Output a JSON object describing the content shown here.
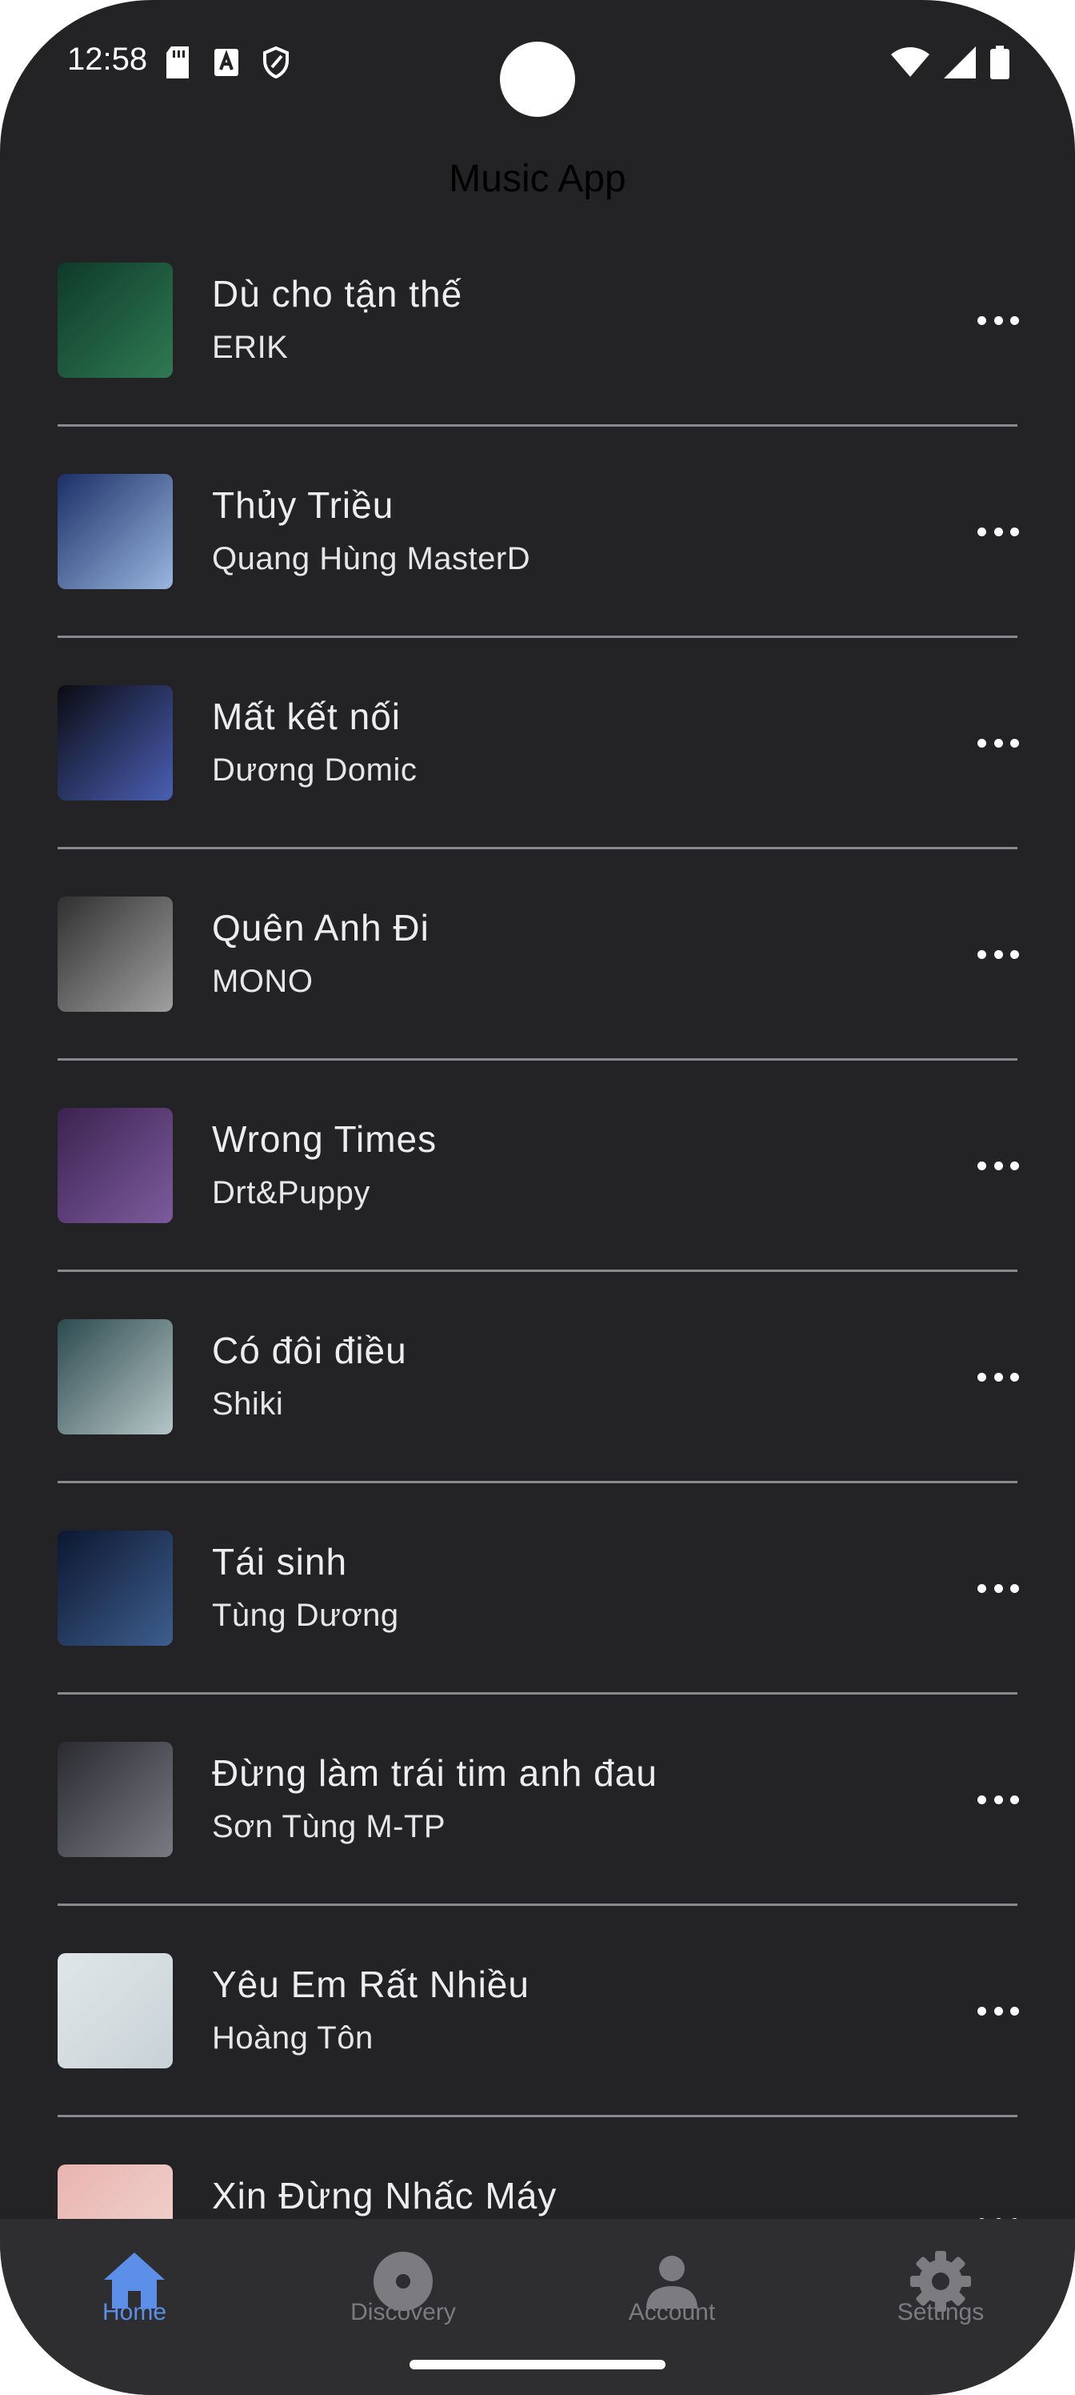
{
  "status": {
    "time": "12:58",
    "left_icons": [
      "sd-card-icon",
      "text-a-icon",
      "shield-icon"
    ],
    "right_icons": [
      "wifi-icon",
      "signal-icon",
      "battery-icon"
    ]
  },
  "app": {
    "title": "Music App"
  },
  "songs": [
    {
      "title": "Dù cho tận thế",
      "artist": "ERIK",
      "thumb_colors": [
        "#0f3a2a",
        "#2e7a52"
      ]
    },
    {
      "title": "Thủy Triều",
      "artist": "Quang Hùng MasterD",
      "thumb_colors": [
        "#1b2f66",
        "#9ab6e0"
      ]
    },
    {
      "title": "Mất kết nối",
      "artist": "Dương Domic",
      "thumb_colors": [
        "#0b0b12",
        "#4a5fb4"
      ]
    },
    {
      "title": "Quên Anh Đi",
      "artist": "MONO",
      "thumb_colors": [
        "#303030",
        "#a0a0a0"
      ]
    },
    {
      "title": "Wrong Times",
      "artist": "Drt&Puppy",
      "thumb_colors": [
        "#3b2350",
        "#7d5b9e"
      ]
    },
    {
      "title": "Có đôi điều",
      "artist": "Shiki",
      "thumb_colors": [
        "#2c4a4e",
        "#b6c6c8"
      ]
    },
    {
      "title": "Tái sinh",
      "artist": "Tùng Dương",
      "thumb_colors": [
        "#0d1730",
        "#3d5e8e"
      ]
    },
    {
      "title": "Đừng làm trái tim anh đau",
      "artist": "Sơn Tùng M-TP",
      "thumb_colors": [
        "#2a2a30",
        "#7a7a84"
      ]
    },
    {
      "title": "Yêu Em Rất Nhiều",
      "artist": "Hoàng Tôn",
      "thumb_colors": [
        "#dfe6e8",
        "#c8d2d6"
      ]
    },
    {
      "title": "Xin Đừng Nhấc Máy",
      "artist": "",
      "thumb_colors": [
        "#e8b4b0",
        "#f2d6d2"
      ]
    }
  ],
  "nav": {
    "items": [
      {
        "label": "Home",
        "icon": "home-icon",
        "active": true
      },
      {
        "label": "Discovery",
        "icon": "disc-icon",
        "active": false
      },
      {
        "label": "Account",
        "icon": "person-icon",
        "active": false
      },
      {
        "label": "Settings",
        "icon": "gear-icon",
        "active": false
      }
    ],
    "active_color": "#5b8fe8",
    "inactive_color": "#7b7b80"
  }
}
